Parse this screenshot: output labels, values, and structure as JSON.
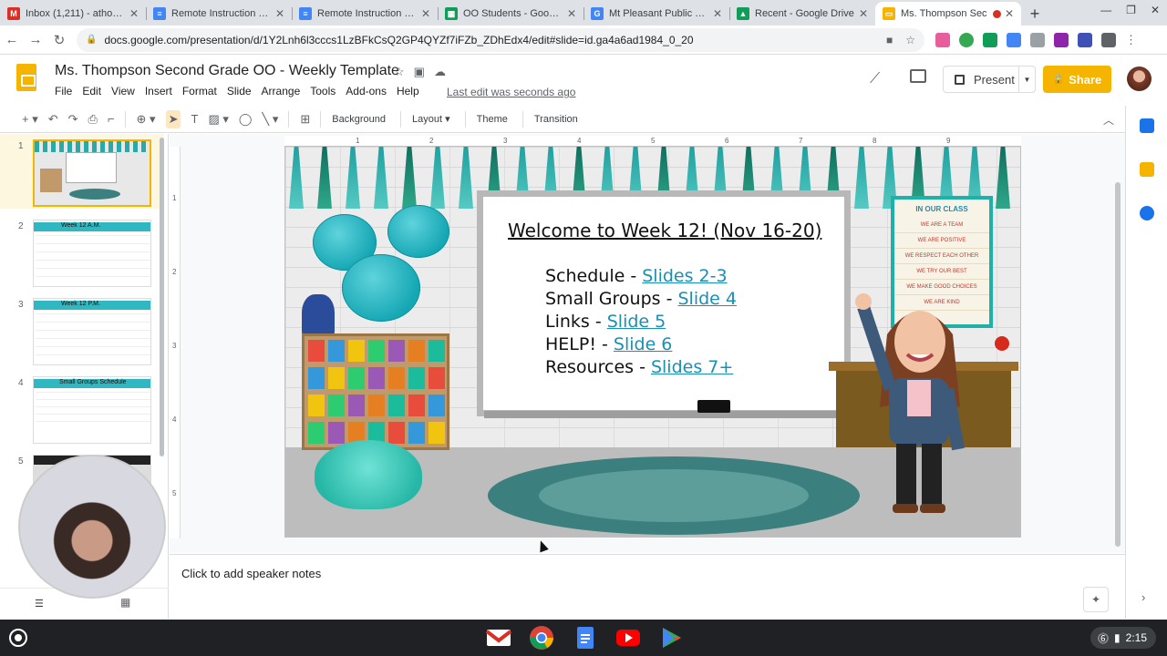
{
  "tabs": [
    {
      "label": "Inbox (1,211) - athomp",
      "color": "#d93025",
      "glyph": "M"
    },
    {
      "label": "Remote Instruction Ser",
      "color": "#4285f4",
      "glyph": "≡"
    },
    {
      "label": "Remote Instruction Ser",
      "color": "#4285f4",
      "glyph": "≡"
    },
    {
      "label": "OO Students - Google S",
      "color": "#0f9d58",
      "glyph": "▦"
    },
    {
      "label": "Mt Pleasant Public Sch",
      "color": "#4285f4",
      "glyph": "G"
    },
    {
      "label": "Recent - Google Drive",
      "color": "#0f9d58",
      "glyph": "▲"
    },
    {
      "label": "Ms. Thompson Sec",
      "color": "#f4b400",
      "glyph": "▭"
    }
  ],
  "url": "docs.google.com/presentation/d/1Y2Lnh6l3cccs1LzBFkCsQ2GP4QYZf7iFZb_ZDhEdx4/edit#slide=id.ga4a6ad1984_0_20",
  "doc": {
    "title": "Ms. Thompson Second Grade OO - Weekly Template",
    "last_edit": "Last edit was seconds ago"
  },
  "menu": [
    "File",
    "Edit",
    "View",
    "Insert",
    "Format",
    "Slide",
    "Arrange",
    "Tools",
    "Add-ons",
    "Help"
  ],
  "header": {
    "present_label": "Present",
    "share_label": "Share"
  },
  "toolbar": {
    "background_label": "Background",
    "layout_label": "Layout",
    "theme_label": "Theme",
    "transition_label": "Transition"
  },
  "ruler": {
    "h": [
      "1",
      "2",
      "3",
      "4",
      "5",
      "6",
      "7",
      "8",
      "9"
    ],
    "v": [
      "1",
      "2",
      "3",
      "4",
      "5"
    ]
  },
  "thumbnails": [
    {
      "num": "1"
    },
    {
      "num": "2",
      "label": "Week 12 A.M."
    },
    {
      "num": "3",
      "label": "Week 12 P.M."
    },
    {
      "num": "4",
      "label": "Small Groups Schedule"
    },
    {
      "num": "5"
    }
  ],
  "slide": {
    "welcome": "Welcome to Week 12! (Nov 16-20)",
    "items": [
      {
        "text": "Schedule - ",
        "link": "Slides 2-3"
      },
      {
        "text": "Small Groups - ",
        "link": "Slide 4"
      },
      {
        "text": "Links - ",
        "link": "Slide 5"
      },
      {
        "text": "HELP! - ",
        "link": "Slide 6"
      },
      {
        "text": "Resources - ",
        "link": "Slides 7+"
      }
    ],
    "poster_title": "IN OUR CLASS",
    "poster_lines": [
      "WE ARE A TEAM",
      "WE ARE POSITIVE",
      "WE RESPECT EACH OTHER",
      "WE TRY OUR BEST",
      "WE MAKE GOOD CHOICES",
      "WE ARE KIND"
    ]
  },
  "notes": {
    "placeholder": "Click to add speaker notes"
  },
  "system": {
    "time": "2:15"
  }
}
